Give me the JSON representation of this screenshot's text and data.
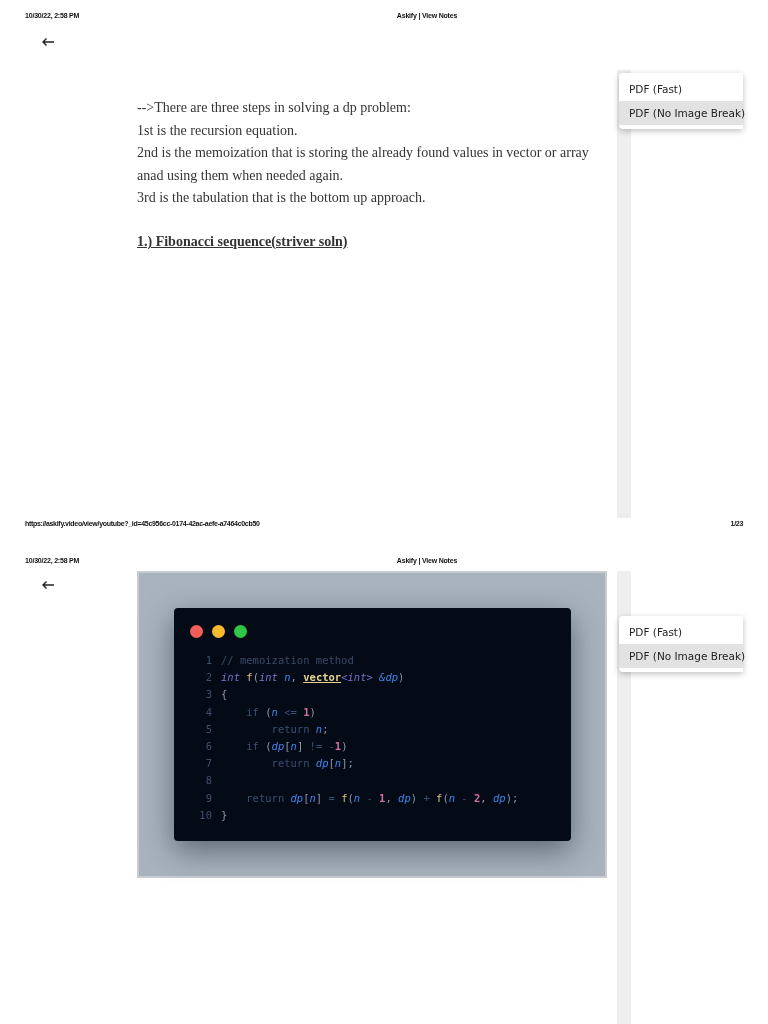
{
  "pages": [
    {
      "header": {
        "date": "10/30/22, 2:58 PM",
        "title": "Askify | View Notes"
      },
      "blocks": [
        {
          "kind": "paragraph",
          "lines": [
            "-->There are three steps in solving a dp problem:",
            "1st is the recursion equation.",
            "2nd is the memoization that is storing the already found values in vector or array anad using them when needed again.",
            "3rd is the tabulation that is the bottom up approach."
          ]
        },
        {
          "kind": "heading",
          "text": "1.) Fibonacci sequence(striver soln)"
        }
      ],
      "export_menu": {
        "items": [
          {
            "label": "PDF (Fast)",
            "selected": false
          },
          {
            "label": "PDF (No Image Break)",
            "selected": true
          }
        ]
      },
      "footer": {
        "url": "https://askify.video/view/youtube?_id=45c956cc-0174-42ac-aefe-a7464c0cb50",
        "page": "1/23"
      }
    },
    {
      "header": {
        "date": "10/30/22, 2:58 PM",
        "title": "Askify | View Notes"
      },
      "blocks": [
        {
          "kind": "code_image",
          "lines": [
            {
              "number": "1",
              "tokens": [
                {
                  "kind": "comment",
                  "text": "// memoization method"
                }
              ]
            },
            {
              "number": "2",
              "tokens": [
                {
                  "kind": "type",
                  "text": "int "
                },
                {
                  "kind": "func",
                  "text": "f"
                },
                {
                  "kind": "punct",
                  "text": "("
                },
                {
                  "kind": "type",
                  "text": "int "
                },
                {
                  "kind": "param",
                  "text": "n"
                },
                {
                  "kind": "punct",
                  "text": ", "
                },
                {
                  "kind": "class",
                  "text": "vector"
                },
                {
                  "kind": "type",
                  "text": "<int> "
                },
                {
                  "kind": "param",
                  "text": "&dp"
                },
                {
                  "kind": "punct",
                  "text": ")"
                }
              ]
            },
            {
              "number": "3",
              "tokens": [
                {
                  "kind": "punct",
                  "text": "{"
                }
              ]
            },
            {
              "number": "4",
              "tokens": [
                {
                  "kind": "keyword",
                  "text": "    if "
                },
                {
                  "kind": "punct",
                  "text": "("
                },
                {
                  "kind": "param",
                  "text": "n"
                },
                {
                  "kind": "keyword",
                  "text": " <= "
                },
                {
                  "kind": "number",
                  "text": "1"
                },
                {
                  "kind": "punct",
                  "text": ")"
                }
              ]
            },
            {
              "number": "5",
              "tokens": [
                {
                  "kind": "keyword",
                  "text": "        return "
                },
                {
                  "kind": "param",
                  "text": "n"
                },
                {
                  "kind": "punct",
                  "text": ";"
                }
              ]
            },
            {
              "number": "6",
              "tokens": [
                {
                  "kind": "keyword",
                  "text": "    if "
                },
                {
                  "kind": "punct",
                  "text": "("
                },
                {
                  "kind": "param",
                  "text": "dp"
                },
                {
                  "kind": "punct",
                  "text": "["
                },
                {
                  "kind": "param",
                  "text": "n"
                },
                {
                  "kind": "punct",
                  "text": "]"
                },
                {
                  "kind": "keyword",
                  "text": " != -"
                },
                {
                  "kind": "number",
                  "text": "1"
                },
                {
                  "kind": "punct",
                  "text": ")"
                }
              ]
            },
            {
              "number": "7",
              "tokens": [
                {
                  "kind": "keyword",
                  "text": "        return "
                },
                {
                  "kind": "param",
                  "text": "dp"
                },
                {
                  "kind": "punct",
                  "text": "["
                },
                {
                  "kind": "param",
                  "text": "n"
                },
                {
                  "kind": "punct",
                  "text": "];"
                }
              ]
            },
            {
              "number": "8"
            },
            {
              "number": "9",
              "tokens": [
                {
                  "kind": "keyword",
                  "text": "    return "
                },
                {
                  "kind": "param",
                  "text": "dp"
                },
                {
                  "kind": "punct",
                  "text": "["
                },
                {
                  "kind": "param",
                  "text": "n"
                },
                {
                  "kind": "punct",
                  "text": "]"
                },
                {
                  "kind": "keyword",
                  "text": " = "
                },
                {
                  "kind": "func",
                  "text": "f"
                },
                {
                  "kind": "punct",
                  "text": "("
                },
                {
                  "kind": "param",
                  "text": "n"
                },
                {
                  "kind": "keyword",
                  "text": " - "
                },
                {
                  "kind": "number",
                  "text": "1"
                },
                {
                  "kind": "punct",
                  "text": ", "
                },
                {
                  "kind": "param",
                  "text": "dp"
                },
                {
                  "kind": "punct",
                  "text": ")"
                },
                {
                  "kind": "keyword",
                  "text": " + "
                },
                {
                  "kind": "func",
                  "text": "f"
                },
                {
                  "kind": "punct",
                  "text": "("
                },
                {
                  "kind": "param",
                  "text": "n"
                },
                {
                  "kind": "keyword",
                  "text": " - "
                },
                {
                  "kind": "number",
                  "text": "2"
                },
                {
                  "kind": "punct",
                  "text": ", "
                },
                {
                  "kind": "param",
                  "text": "dp"
                },
                {
                  "kind": "punct",
                  "text": ");"
                }
              ]
            },
            {
              "number": "10",
              "tokens": [
                {
                  "kind": "punct",
                  "text": "}"
                }
              ]
            }
          ]
        }
      ],
      "export_menu": {
        "items": [
          {
            "label": "PDF (Fast)",
            "selected": false
          },
          {
            "label": "PDF (No Image Break)",
            "selected": true
          }
        ]
      }
    }
  ]
}
